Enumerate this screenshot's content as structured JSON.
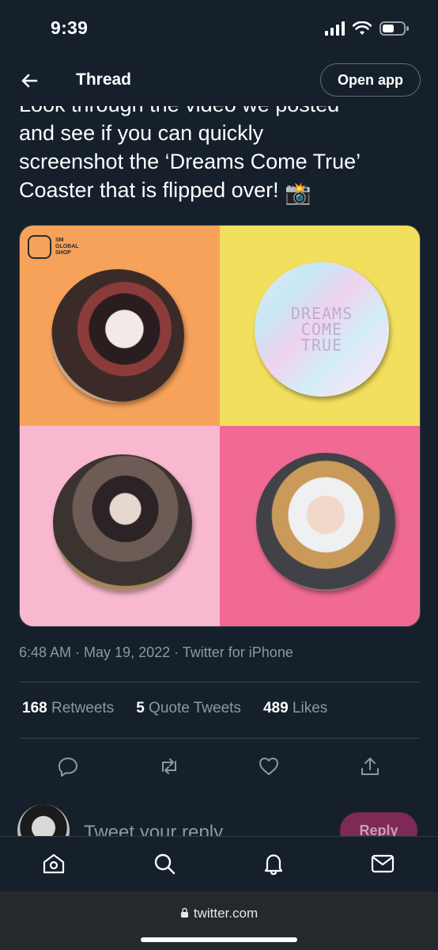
{
  "status_bar": {
    "time": "9:39"
  },
  "header": {
    "title": "Thread",
    "open_app_label": "Open app"
  },
  "tweet": {
    "text_line0": "Look through the video we posted",
    "text_line1": "and see if you can quickly",
    "text_line2": "screenshot the ‘Dreams Come True’",
    "text_line3": "Coaster that is flipped over!",
    "emoji": "📸",
    "media": {
      "brand_lines": [
        "SM",
        "GLOBAL",
        "SHOP"
      ],
      "hologram_text": [
        "DREAMS",
        "COME",
        "TRUE"
      ]
    },
    "timestamp": "6:48 AM · May 19, 2022 · Twitter for iPhone"
  },
  "stats": {
    "retweets_count": "168",
    "retweets_label": "Retweets",
    "quotes_count": "5",
    "quotes_label": "Quote Tweets",
    "likes_count": "489",
    "likes_label": "Likes"
  },
  "reply": {
    "placeholder": "Tweet your reply",
    "button_label": "Reply"
  },
  "browser": {
    "url": "twitter.com"
  },
  "colors": {
    "background": "#15202b",
    "secondary_text": "#8b98a5",
    "reply_button": "#7d2a57"
  }
}
